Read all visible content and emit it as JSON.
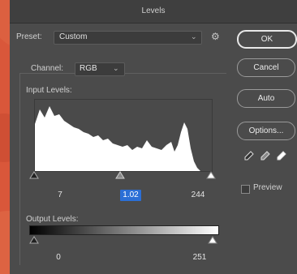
{
  "dialog": {
    "title": "Levels"
  },
  "preset": {
    "label": "Preset:",
    "value": "Custom"
  },
  "channel": {
    "label": "Channel:",
    "value": "RGB"
  },
  "input_levels": {
    "label": "Input Levels:",
    "black": "7",
    "gamma": "1.02",
    "white": "244"
  },
  "output_levels": {
    "label": "Output Levels:",
    "black": "0",
    "white": "251"
  },
  "buttons": {
    "ok": "OK",
    "cancel": "Cancel",
    "auto": "Auto",
    "options": "Options..."
  },
  "preview": {
    "label": "Preview",
    "checked": false
  },
  "colors": {
    "background": "#d9573a",
    "dialog": "#4b4b4b",
    "accent": "#2b6fd6"
  },
  "icons": [
    "gear-icon",
    "chevron-down-icon",
    "black-point-eyedropper-icon",
    "gray-point-eyedropper-icon",
    "white-point-eyedropper-icon",
    "slider-handle-icon"
  ]
}
